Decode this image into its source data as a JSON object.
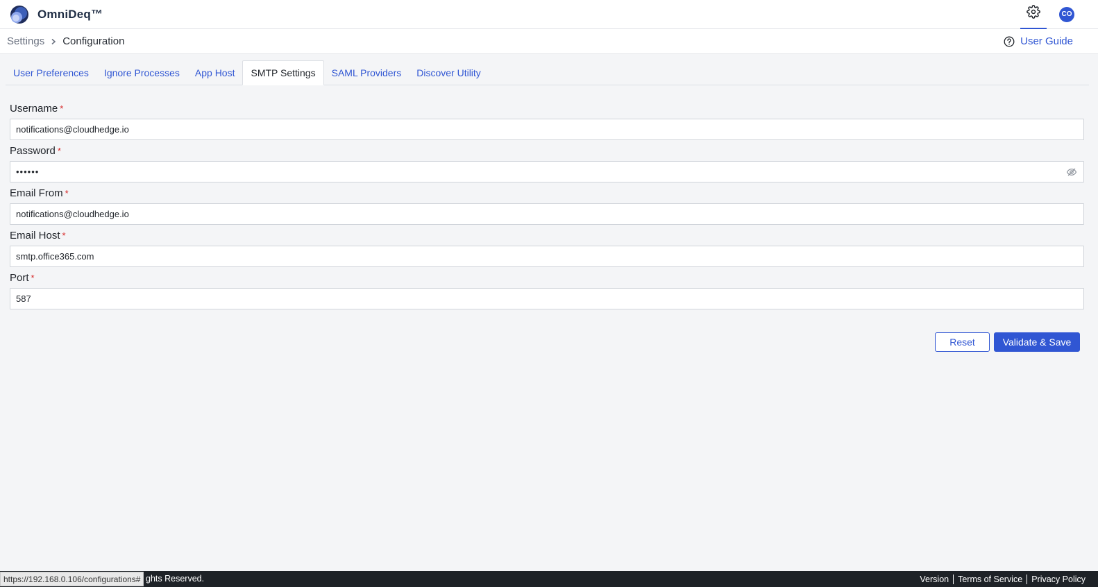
{
  "app": {
    "name": "OmniDeq™",
    "logo_icon": "omnideq-logo-icon"
  },
  "header": {
    "settings_icon": "gear-icon",
    "avatar_initials": "CO",
    "accent": "#3056d3"
  },
  "breadcrumb": {
    "parent": "Settings",
    "current": "Configuration"
  },
  "help": {
    "label": "User Guide",
    "icon": "question-circle-icon"
  },
  "tabs": [
    {
      "label": "User Preferences",
      "active": false
    },
    {
      "label": "Ignore Processes",
      "active": false
    },
    {
      "label": "App Host",
      "active": false
    },
    {
      "label": "SMTP Settings",
      "active": true
    },
    {
      "label": "SAML Providers",
      "active": false
    },
    {
      "label": "Discover Utility",
      "active": false
    }
  ],
  "form": {
    "username": {
      "label": "Username",
      "required": "*",
      "value": "notifications@cloudhedge.io"
    },
    "password": {
      "label": "Password",
      "required": "*",
      "value": "••••••",
      "toggle_icon": "eye-slash-icon"
    },
    "email_from": {
      "label": "Email From",
      "required": "*",
      "value": "notifications@cloudhedge.io"
    },
    "email_host": {
      "label": "Email Host",
      "required": "*",
      "value": "smtp.office365.com"
    },
    "port": {
      "label": "Port",
      "required": "*",
      "value": "587"
    }
  },
  "actions": {
    "reset_label": "Reset",
    "save_label": "Validate & Save"
  },
  "footer": {
    "copyright_visible": "ghts Reserved.",
    "status_url": "https://192.168.0.106/configurations#",
    "links": [
      "Version",
      "Terms of Service",
      "Privacy Policy"
    ]
  }
}
